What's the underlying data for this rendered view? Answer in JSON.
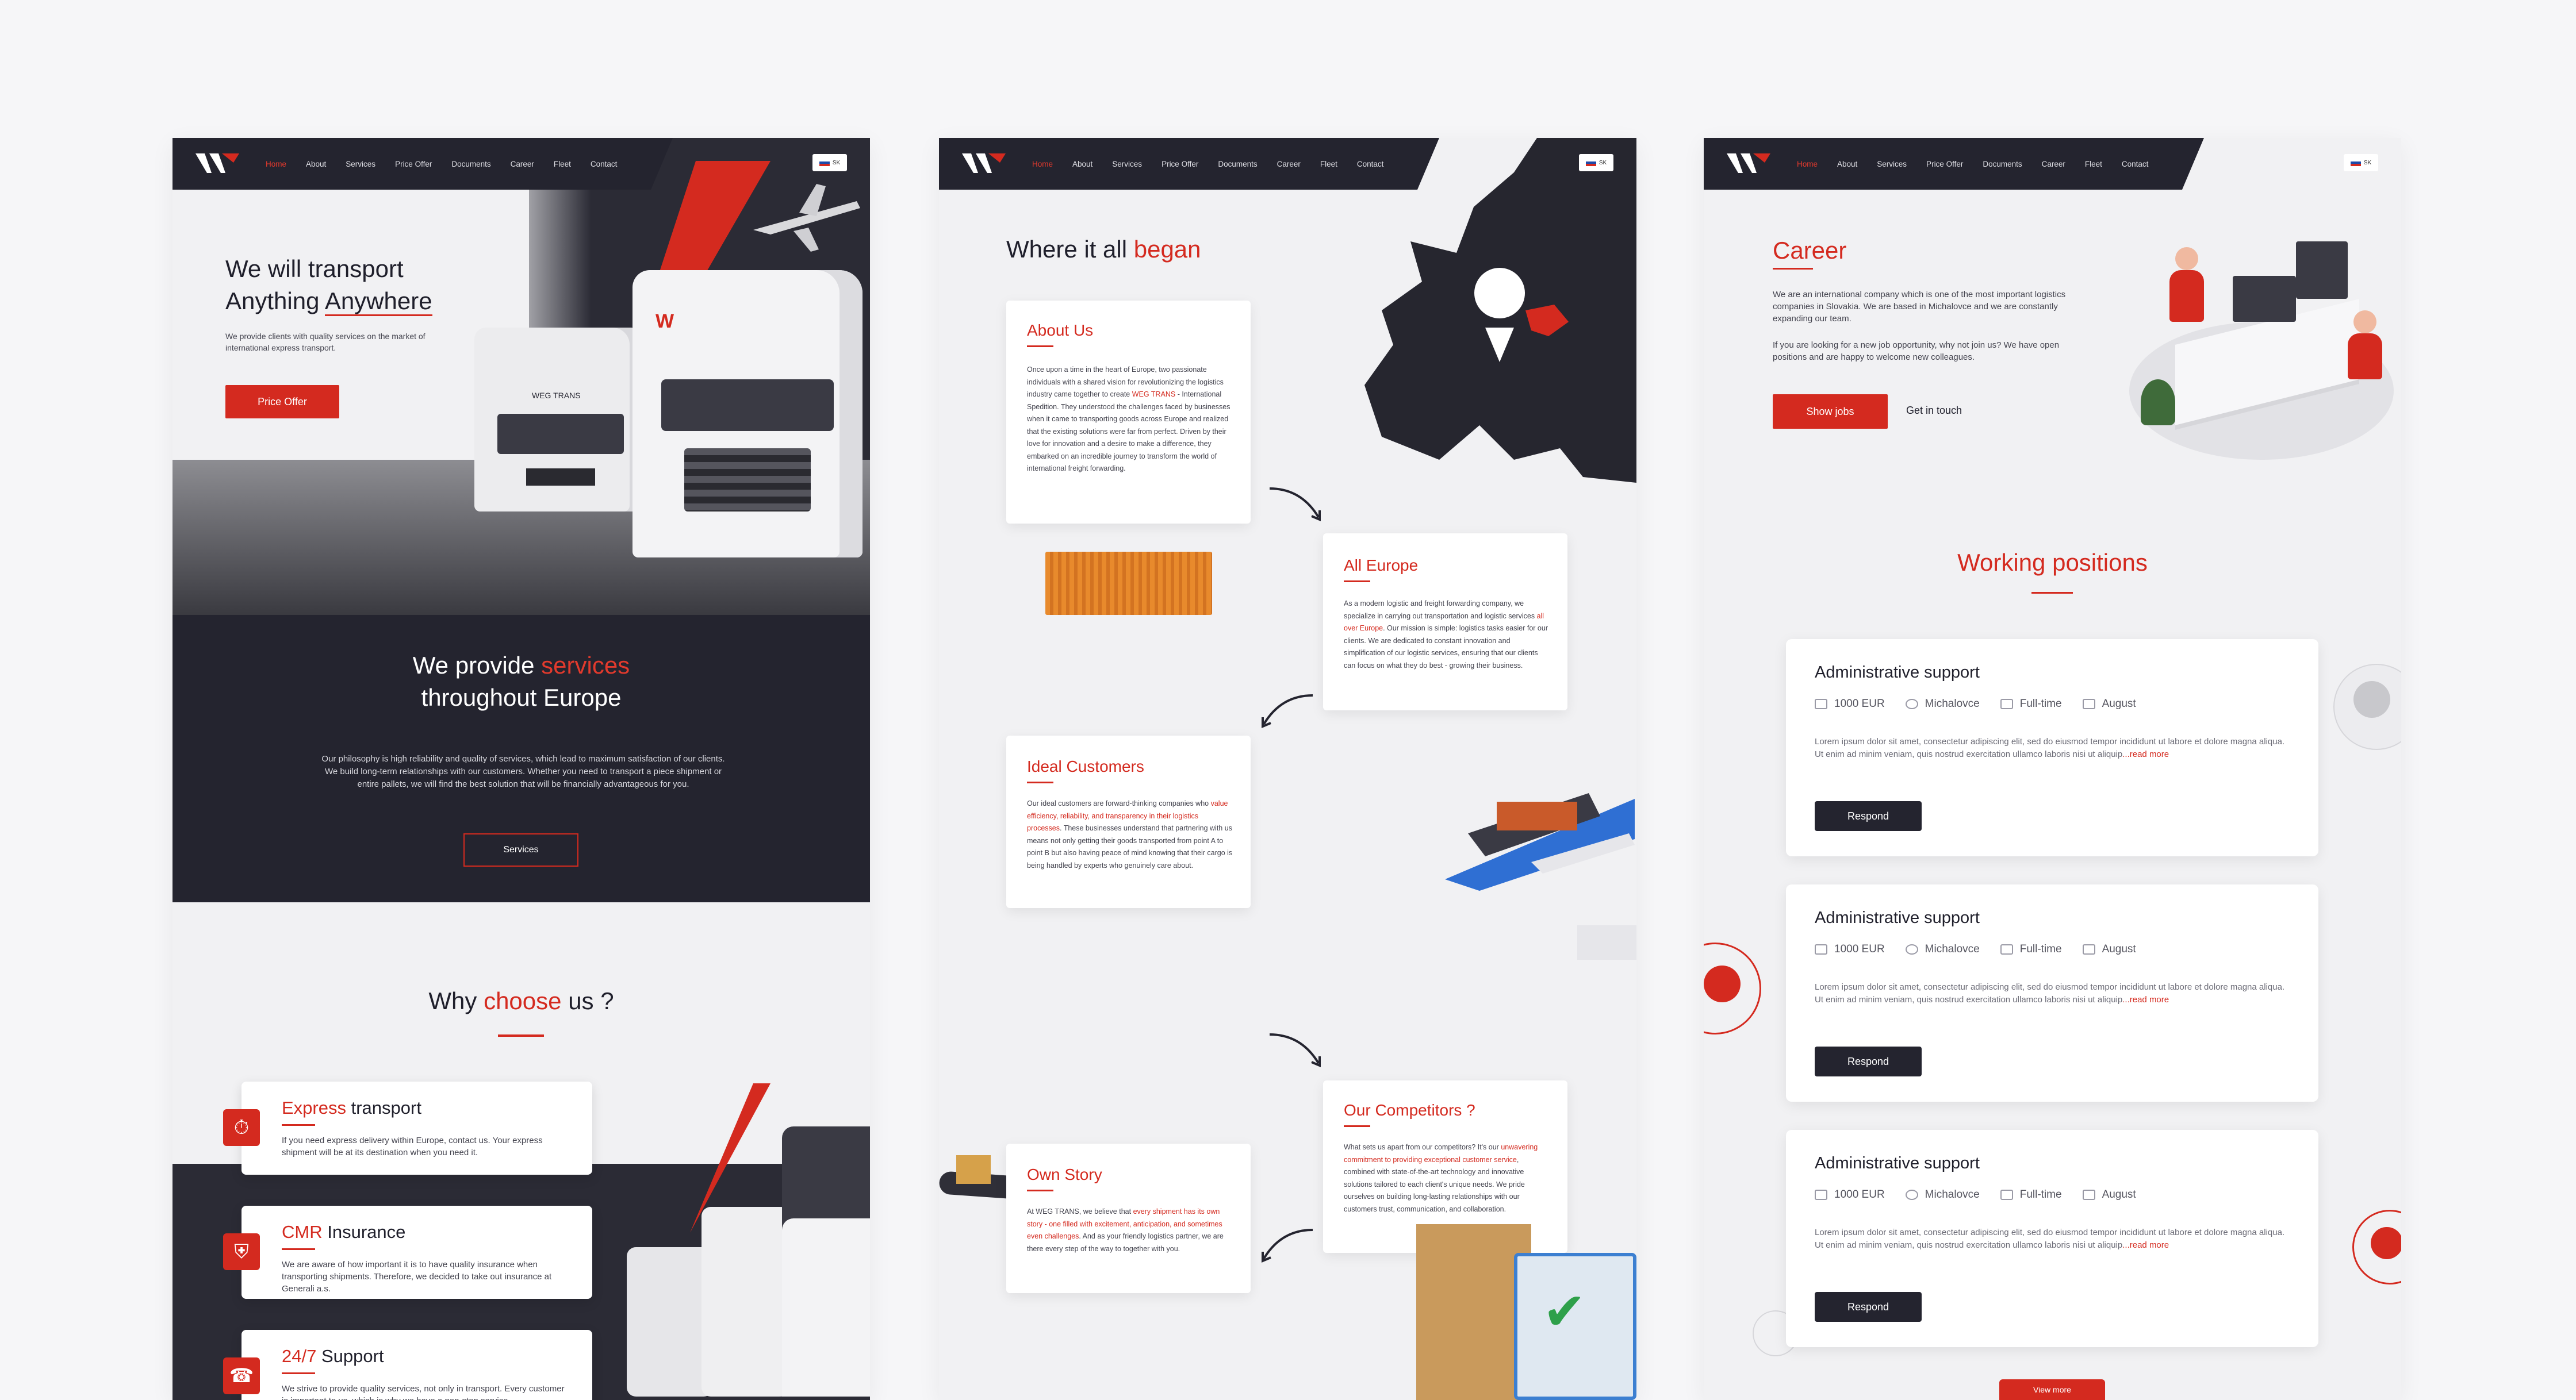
{
  "nav": {
    "items": [
      "Home",
      "About",
      "Services",
      "Price Offer",
      "Documents",
      "Career",
      "Fleet",
      "Contact"
    ],
    "lang": "SK"
  },
  "home": {
    "hero_title_line1": "We will transport",
    "hero_title_line2_a": "Anything",
    "hero_title_line2_b": "Anywhere",
    "hero_sub": "We provide clients with quality services on the market of international express transport.",
    "cta": "Price Offer",
    "truck_badge": "WEG TRANS",
    "services_title_a": "We provide",
    "services_title_b": "services",
    "services_title_c": "throughout Europe",
    "services_text": "Our philosophy is high reliability and quality of services, which lead to maximum satisfaction of our clients. We build long-term relationships with our customers. Whether you need to transport a piece shipment or entire pallets, we will find the best solution that will be financially advantageous for you.",
    "services_btn": "Services",
    "why_a": "Why",
    "why_b": "choose",
    "why_c": "us ?",
    "features": [
      {
        "title_a": "Express",
        "title_b": " transport",
        "text": "If you need express delivery within Europe, contact us. Your express shipment will be at its destination when you need it.",
        "icon": "stopwatch-icon"
      },
      {
        "title_a": "CMR",
        "title_b": " Insurance",
        "text": "We are aware of how important it is to have quality insurance when transporting shipments. Therefore, we decided to take out insurance at Generali a.s.",
        "icon": "shield-icon"
      },
      {
        "title_a": "24/7",
        "title_b": " Support",
        "text": "We strive to provide quality services, not only in transport. Every customer is important to us, which is why we have a non-stop service.",
        "icon": "headset-icon"
      }
    ]
  },
  "about": {
    "title_a": "Where it all",
    "title_b": "began",
    "cards": [
      {
        "title": "About Us",
        "text_pre": "Once upon a time in the heart of Europe, two passionate individuals with a shared vision for revolutionizing the logistics industry came together to create ",
        "text_hl": "WEG TRANS",
        "text_post": " - International Spedition. They understood the challenges faced by businesses when it came to transporting goods across Europe and realized that the existing solutions were far from perfect. Driven by their love for innovation and a desire to make a difference, they embarked on an incredible journey to transform the world of international freight forwarding."
      },
      {
        "title": "All Europe",
        "text_pre": "As a modern logistic and freight forwarding company, we specialize in carrying out transportation and logistic services ",
        "text_hl": "all over Europe",
        "text_post": ". Our mission is simple: logistics tasks easier for our clients. We are dedicated to constant innovation and simplification of our logistic services, ensuring that our clients can focus on what they do best - growing their business."
      },
      {
        "title": "Ideal Customers",
        "text_pre": "Our ideal customers are forward-thinking companies who ",
        "text_hl": "value efficiency, reliability, and transparency in their logistics processes",
        "text_post": ". These businesses understand that partnering with us means not only getting their goods transported from point A to point B but also having peace of mind knowing that their cargo is being handled by experts who genuinely care about."
      },
      {
        "title": "Our Competitors ?",
        "text_pre": "What sets us apart from our competitors? It's our ",
        "text_hl": "unwavering commitment to providing exceptional customer service",
        "text_post": ", combined with state-of-the-art technology and innovative solutions tailored to each client's unique needs. We pride ourselves on building long-lasting relationships with our customers trust, communication, and collaboration."
      },
      {
        "title": "Own Story",
        "text_pre": "At WEG TRANS, we believe that ",
        "text_hl": "every shipment has its own story - one filled with excitement, anticipation, and sometimes even challenges",
        "text_post": ". And as your friendly logistics partner, we are there every step of the way to together with you."
      }
    ]
  },
  "career": {
    "title": "Career",
    "p1": "We are an international company which is one of the most important logistics companies in Slovakia. We are based in Michalovce and we are constantly expanding our team.",
    "p2": "If you are looking for a new job opportunity, why not join us? We have open positions and are happy to welcome new colleagues.",
    "btn_jobs": "Show jobs",
    "btn_touch": "Get in touch",
    "positions_title": "Working positions",
    "jobs": [
      {
        "title": "Administrative support",
        "salary": "1000 EUR",
        "location": "Michalovce",
        "type": "Full-time",
        "start": "August",
        "text": "Lorem ipsum dolor sit amet, consectetur adipiscing elit, sed do eiusmod tempor incididunt ut labore et dolore magna aliqua. Ut enim ad minim veniam, quis nostrud exercitation ullamco laboris nisi ut aliquip",
        "more": "...read more",
        "btn": "Respond"
      },
      {
        "title": "Administrative support",
        "salary": "1000 EUR",
        "location": "Michalovce",
        "type": "Full-time",
        "start": "August",
        "text": "Lorem ipsum dolor sit amet, consectetur adipiscing elit, sed do eiusmod tempor incididunt ut labore et dolore magna aliqua. Ut enim ad minim veniam, quis nostrud exercitation ullamco laboris nisi ut aliquip",
        "more": "...read more",
        "btn": "Respond"
      },
      {
        "title": "Administrative support",
        "salary": "1000 EUR",
        "location": "Michalovce",
        "type": "Full-time",
        "start": "August",
        "text": "Lorem ipsum dolor sit amet, consectetur adipiscing elit, sed do eiusmod tempor incididunt ut labore et dolore magna aliqua. Ut enim ad minim veniam, quis nostrud exercitation ullamco laboris nisi ut aliquip",
        "more": "...read more",
        "btn": "Respond"
      }
    ],
    "view_more": "View more"
  },
  "colors": {
    "accent": "#d42a1f",
    "dark": "#24242f",
    "bg": "#f1f1f3"
  }
}
